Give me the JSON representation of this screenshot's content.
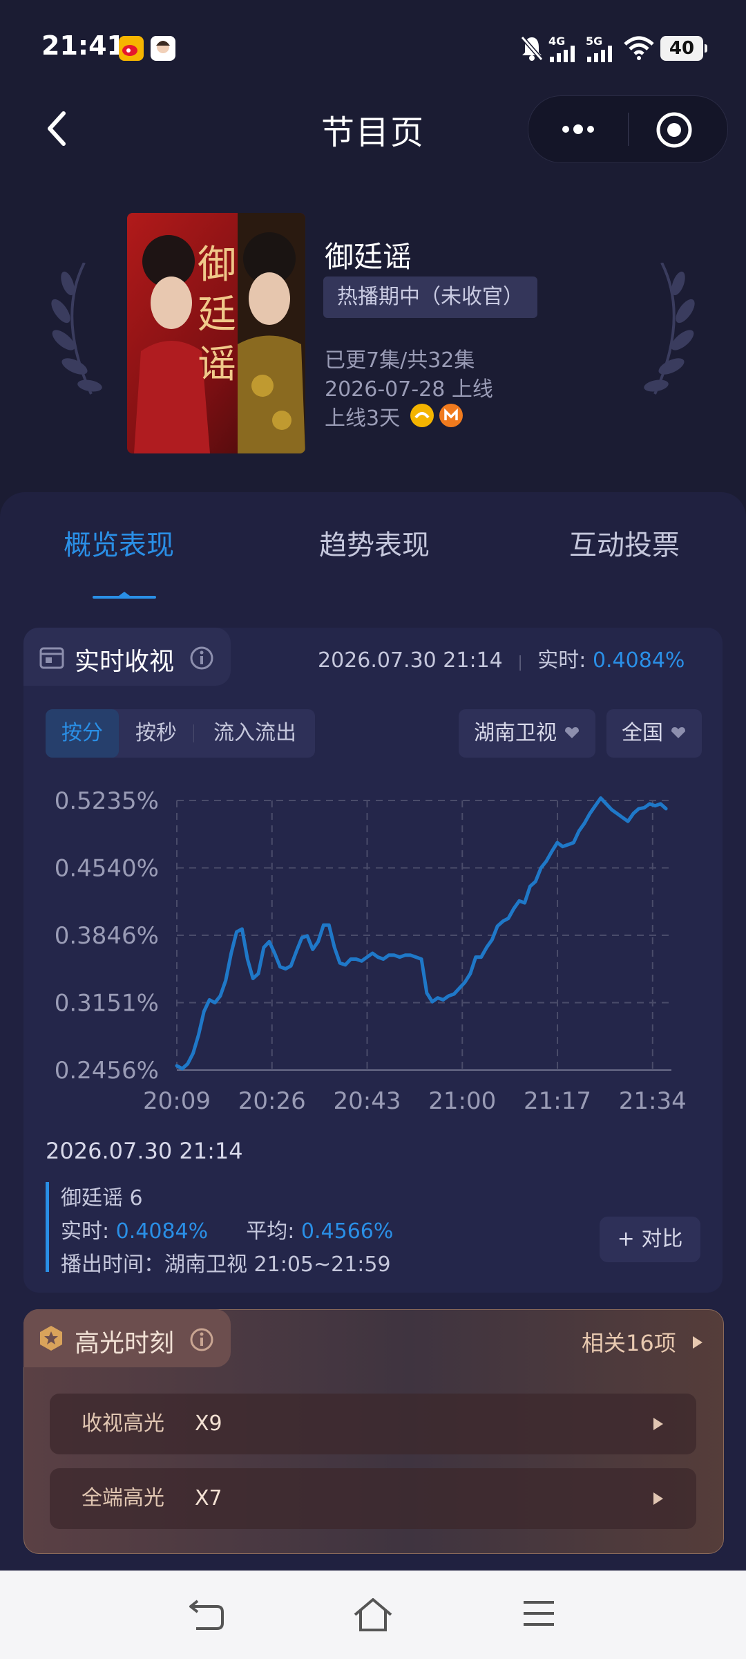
{
  "status_bar": {
    "time": "21:41",
    "net1": "4G",
    "net2": "5G",
    "battery": "40",
    "icons": [
      "weibo-icon",
      "avatar-app-icon",
      "mute-icon",
      "signal-icon",
      "signal-icon",
      "wifi-icon"
    ]
  },
  "header": {
    "title": "节目页",
    "back_icon": "chevron-left-icon",
    "more_icon": "more-dots-icon",
    "target_icon": "target-icon"
  },
  "show": {
    "title": "御廷谣",
    "status_tag": "热播期中（未收官）",
    "episodes": "已更7集/共32集",
    "release": "2026-07-28 上线",
    "days_online": "上线3天",
    "poster_text": "御廷谣",
    "platforms": [
      "mango-tv-icon",
      "imgo-icon"
    ]
  },
  "tabs": [
    {
      "label": "概览表现",
      "active": true
    },
    {
      "label": "趋势表现",
      "active": false
    },
    {
      "label": "互动投票",
      "active": false
    }
  ],
  "realtime": {
    "title": "实时收视",
    "timestamp": "2026.07.30 21:14",
    "rt_label": "实时:",
    "rt_value": "0.4084%",
    "segments": [
      {
        "label": "按分",
        "active": true
      },
      {
        "label": "按秒",
        "active": false
      },
      {
        "label": "流入流出",
        "active": false
      }
    ],
    "channel": "湖南卫视",
    "region": "全国"
  },
  "chart_data": {
    "type": "line",
    "title": "",
    "xlabel": "",
    "ylabel": "",
    "x_ticks": [
      "20:09",
      "20:26",
      "20:43",
      "21:00",
      "21:17",
      "21:34"
    ],
    "y_ticks": [
      "0.5235%",
      "0.4540%",
      "0.3846%",
      "0.3151%",
      "0.2456%"
    ],
    "ylim": [
      0.2456,
      0.5235
    ],
    "x_range_minutes": [
      0,
      91
    ],
    "grid": true,
    "series": [
      {
        "name": "",
        "color": "#1f78c8",
        "x": [
          0,
          1,
          2,
          3,
          4,
          5,
          6,
          7,
          8,
          9,
          10,
          11,
          12,
          13,
          14,
          15,
          16,
          17,
          18,
          19,
          20,
          21,
          22,
          23,
          24,
          25,
          26,
          27,
          28,
          29,
          30,
          31,
          32,
          33,
          34,
          35,
          36,
          37,
          38,
          39,
          40,
          41,
          42,
          43,
          44,
          45,
          46,
          47,
          48,
          49,
          50,
          51,
          52,
          53,
          54,
          55,
          56,
          57,
          58,
          59,
          60,
          61,
          62,
          63,
          64,
          65,
          66,
          67,
          68,
          69,
          70,
          71,
          72,
          73,
          74,
          75,
          76,
          77,
          78,
          79,
          80,
          81,
          82,
          83,
          84,
          85,
          86,
          87,
          88,
          89,
          90
        ],
        "y": [
          0.25,
          0.247,
          0.252,
          0.263,
          0.282,
          0.306,
          0.318,
          0.315,
          0.322,
          0.338,
          0.366,
          0.388,
          0.391,
          0.36,
          0.34,
          0.345,
          0.372,
          0.378,
          0.366,
          0.352,
          0.35,
          0.353,
          0.368,
          0.382,
          0.384,
          0.37,
          0.378,
          0.395,
          0.395,
          0.372,
          0.356,
          0.354,
          0.36,
          0.36,
          0.358,
          0.362,
          0.366,
          0.362,
          0.36,
          0.364,
          0.364,
          0.362,
          0.364,
          0.364,
          0.362,
          0.36,
          0.325,
          0.316,
          0.32,
          0.318,
          0.322,
          0.324,
          0.33,
          0.336,
          0.345,
          0.362,
          0.362,
          0.372,
          0.38,
          0.394,
          0.399,
          0.402,
          0.412,
          0.42,
          0.418,
          0.435,
          0.44,
          0.454,
          0.461,
          0.471,
          0.48,
          0.476,
          0.478,
          0.48,
          0.492,
          0.5,
          0.51,
          0.518,
          0.526,
          0.52,
          0.514,
          0.51,
          0.506,
          0.502,
          0.51,
          0.515,
          0.516,
          0.52,
          0.518,
          0.52,
          0.515
        ]
      }
    ]
  },
  "detail": {
    "timestamp": "2026.07.30 21:14",
    "episode": "御廷谣 6",
    "rt_label": "实时:",
    "rt_value": "0.4084%",
    "avg_label": "平均:",
    "avg_value": "0.4566%",
    "airtime": "播出时间：湖南卫视 21:05~21:59",
    "compare": "+ 对比"
  },
  "highlights": {
    "title": "高光时刻",
    "related": "相关16项",
    "rows": [
      {
        "label": "收视高光",
        "count": "X9"
      },
      {
        "label": "全端高光",
        "count": "X7"
      }
    ]
  },
  "nav": {
    "icons": [
      "back-nav-icon",
      "home-icon",
      "menu-icon"
    ]
  }
}
